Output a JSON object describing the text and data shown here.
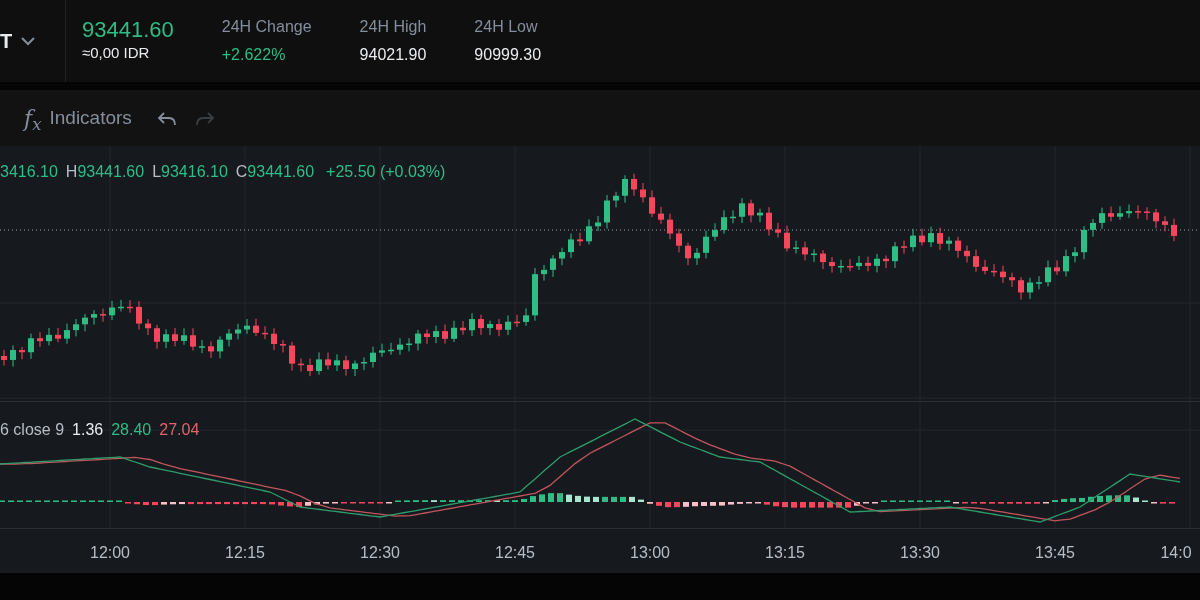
{
  "header": {
    "symbol": "T",
    "price": {
      "text": "93441.60",
      "positive": true
    },
    "fiat_price": "≈0,00 IDR",
    "stats": [
      {
        "label": "24H Change",
        "value": "+2.622%",
        "positive": true
      },
      {
        "label": "24H High",
        "value": "94021.90",
        "positive": false
      },
      {
        "label": "24H Low",
        "value": "90999.30",
        "positive": false
      }
    ]
  },
  "toolbar": {
    "indicators": {
      "icon_text": "f$_{x}$",
      "label": "Indicators"
    },
    "undo": {
      "disabled": false
    },
    "redo": {
      "disabled": true
    }
  },
  "ohlc": {
    "items": [
      {
        "value": "3416.10"
      },
      {
        "label": "H",
        "value": "93441.60"
      },
      {
        "label": "L",
        "value": "93416.10"
      },
      {
        "label": "C",
        "value": "93441.60"
      }
    ],
    "change": "+25.50 (+0.03%)"
  },
  "macd": {
    "params": "6 close 9",
    "values": [
      {
        "text": "1.36",
        "kind": "histogram"
      },
      {
        "text": "28.40",
        "kind": "macd"
      },
      {
        "text": "27.04",
        "kind": "signal"
      }
    ]
  },
  "time_axis": [
    "12:00",
    "12:15",
    "12:30",
    "12:45",
    "13:00",
    "13:15",
    "13:30",
    "13:45",
    "14:0"
  ]
}
